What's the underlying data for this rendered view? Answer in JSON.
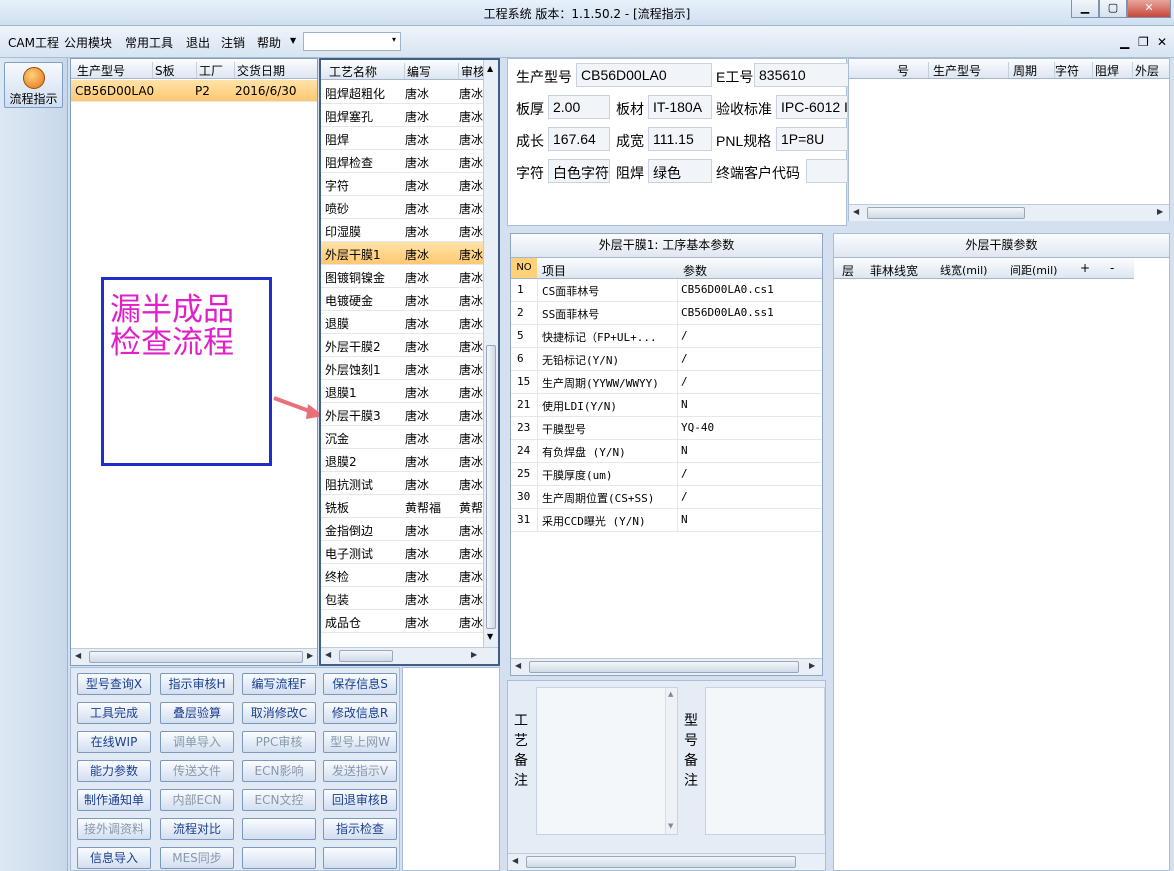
{
  "window": {
    "title": "工程系统   版本：1.1.50.2 - [流程指示]"
  },
  "menu": {
    "items": [
      "CAM工程",
      "公用模块",
      "常用工具",
      "退出",
      "注销",
      "帮助"
    ],
    "dropdown_arrow": "▾"
  },
  "sidebar": {
    "flow_button_label": "流程指示"
  },
  "orders": {
    "headers": [
      "生产型号",
      "S板",
      "工厂",
      "交货日期"
    ],
    "rows": [
      {
        "model": "CB56D00LA0",
        "s": "",
        "factory": "P2",
        "date": "2016/6/30"
      }
    ]
  },
  "annotation": {
    "text_line1": "漏半成品",
    "text_line2": "检查流程"
  },
  "process": {
    "headers": [
      "工艺名称",
      "编写",
      "审核"
    ],
    "rows": [
      {
        "name": "阻焊超粗化",
        "author": "唐冰",
        "reviewer": "唐冰"
      },
      {
        "name": "阻焊塞孔",
        "author": "唐冰",
        "reviewer": "唐冰"
      },
      {
        "name": "阻焊",
        "author": "唐冰",
        "reviewer": "唐冰"
      },
      {
        "name": "阻焊检查",
        "author": "唐冰",
        "reviewer": "唐冰"
      },
      {
        "name": "字符",
        "author": "唐冰",
        "reviewer": "唐冰"
      },
      {
        "name": "喷砂",
        "author": "唐冰",
        "reviewer": "唐冰"
      },
      {
        "name": "印湿膜",
        "author": "唐冰",
        "reviewer": "唐冰"
      },
      {
        "name": "外层干膜1",
        "author": "唐冰",
        "reviewer": "唐冰"
      },
      {
        "name": "图镀铜镍金",
        "author": "唐冰",
        "reviewer": "唐冰"
      },
      {
        "name": "电镀硬金",
        "author": "唐冰",
        "reviewer": "唐冰"
      },
      {
        "name": "退膜",
        "author": "唐冰",
        "reviewer": "唐冰"
      },
      {
        "name": "外层干膜2",
        "author": "唐冰",
        "reviewer": "唐冰"
      },
      {
        "name": "外层蚀刻1",
        "author": "唐冰",
        "reviewer": "唐冰"
      },
      {
        "name": "退膜1",
        "author": "唐冰",
        "reviewer": "唐冰"
      },
      {
        "name": "外层干膜3",
        "author": "唐冰",
        "reviewer": "唐冰"
      },
      {
        "name": "沉金",
        "author": "唐冰",
        "reviewer": "唐冰"
      },
      {
        "name": "退膜2",
        "author": "唐冰",
        "reviewer": "唐冰"
      },
      {
        "name": "阻抗测试",
        "author": "唐冰",
        "reviewer": "唐冰"
      },
      {
        "name": "铣板",
        "author": "黄帮福",
        "reviewer": "黄帮"
      },
      {
        "name": "金指倒边",
        "author": "唐冰",
        "reviewer": "唐冰"
      },
      {
        "name": "电子测试",
        "author": "唐冰",
        "reviewer": "唐冰"
      },
      {
        "name": "终检",
        "author": "唐冰",
        "reviewer": "唐冰"
      },
      {
        "name": "包装",
        "author": "唐冰",
        "reviewer": "唐冰"
      },
      {
        "name": "成品仓",
        "author": "唐冰",
        "reviewer": "唐冰"
      }
    ],
    "selected_index": 7
  },
  "buttons": [
    [
      "型号查询X",
      "指示审核H",
      "编写流程F",
      "保存信息S"
    ],
    [
      "工具完成",
      "叠层验算",
      "取消修改C",
      "修改信息R"
    ],
    [
      "在线WIP",
      "调单导入",
      "PPC审核",
      "型号上网W"
    ],
    [
      "能力参数",
      "传送文件",
      "ECN影响",
      "发送指示V"
    ],
    [
      "制作通知单",
      "内部ECN",
      "ECN文控",
      "回退审核B"
    ],
    [
      "接外调资料",
      "流程对比",
      "",
      "指示检查"
    ],
    [
      "信息导入",
      "MES同步",
      "",
      ""
    ]
  ],
  "buttons_disabled": [
    [
      false,
      false,
      false,
      false
    ],
    [
      false,
      false,
      false,
      false
    ],
    [
      false,
      true,
      true,
      true
    ],
    [
      false,
      true,
      true,
      true
    ],
    [
      false,
      true,
      true,
      false
    ],
    [
      true,
      false,
      false,
      false
    ],
    [
      false,
      true,
      false,
      false
    ]
  ],
  "info": {
    "model_label": "生产型号",
    "model_value": "CB56D00LA0",
    "e_label": "E工号",
    "e_value": "835610",
    "thickness_label": "板厚",
    "thickness_value": "2.00",
    "material_label": "板材",
    "material_value": "IT-180A",
    "std_label": "验收标准",
    "std_value": "IPC-6012 I",
    "len_label": "成长",
    "len_value": "167.64",
    "width_label": "成宽",
    "width_value": "111.15",
    "pnl_label": "PNL规格",
    "pnl_value": "1P=8U",
    "char_label": "字符",
    "char_value": "白色字符",
    "mask_label": "阻焊",
    "mask_value": "绿色",
    "cust_label": "终端客户代码",
    "cust_value": ""
  },
  "right_grid": {
    "headers": [
      "号",
      "生产型号",
      "周期",
      "字符",
      "阻焊",
      "外层"
    ]
  },
  "params": {
    "title": "外层干膜1: 工序基本参数",
    "headers": [
      "NO",
      "项目",
      "参数"
    ],
    "rows": [
      {
        "no": "1",
        "item": "CS面菲林号",
        "value": "CB56D00LA0.cs1"
      },
      {
        "no": "2",
        "item": "SS面菲林号",
        "value": "CB56D00LA0.ss1"
      },
      {
        "no": "5",
        "item": "快捷标记（FP+UL+...",
        "value": "/"
      },
      {
        "no": "6",
        "item": "无铅标记(Y/N)",
        "value": "/"
      },
      {
        "no": "15",
        "item": "生产周期(YYWW/WWYY)",
        "value": "/"
      },
      {
        "no": "21",
        "item": "使用LDI(Y/N)",
        "value": "N"
      },
      {
        "no": "23",
        "item": "干膜型号",
        "value": "YQ-40"
      },
      {
        "no": "24",
        "item": "有负焊盘 (Y/N)",
        "value": "N"
      },
      {
        "no": "25",
        "item": "干膜厚度(um)",
        "value": "/"
      },
      {
        "no": "30",
        "item": "生产周期位置(CS+SS)",
        "value": "/"
      },
      {
        "no": "31",
        "item": "采用CCD曝光 (Y/N)",
        "value": "N"
      }
    ]
  },
  "film": {
    "title": "外层干膜参数",
    "headers": [
      "层",
      "菲林线宽",
      "线宽(mil)",
      "间距(mil)",
      "+",
      "-"
    ]
  },
  "notes": {
    "process_label": "工艺备注",
    "model_label": "型号备注"
  }
}
